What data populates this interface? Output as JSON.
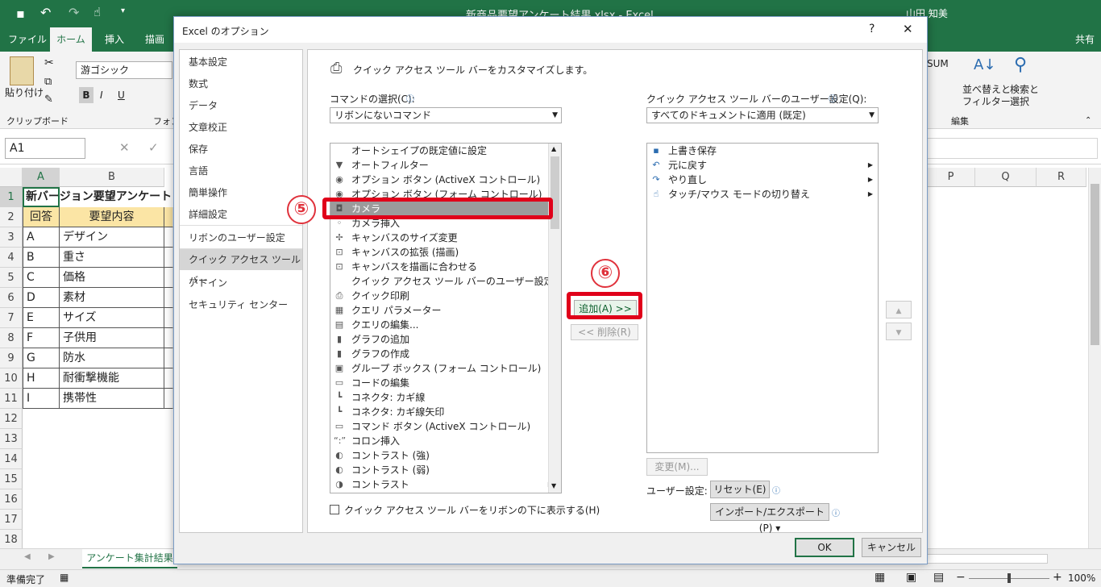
{
  "window": {
    "title": "新商品要望アンケート結果.xlsx  -  Excel",
    "user": "山田 知美"
  },
  "ribbon": {
    "tabs": [
      "ファイル",
      "ホーム",
      "挿入",
      "描画"
    ],
    "share": "共有",
    "paste": "貼り付け",
    "clipboard": "クリップボード",
    "font_name": "游ゴシック",
    "font_group": "フォン",
    "sum": "SUM",
    "sort_filter": "並べ替えと\nフィルター",
    "find_select": "検索と\n選択",
    "edit_group": "編集",
    "bold": "B",
    "italic": "I",
    "underline": "U"
  },
  "formula": {
    "namebox": "A1"
  },
  "sheet": {
    "columns": [
      "A",
      "B",
      "P",
      "Q",
      "R"
    ],
    "rows": [
      "1",
      "2",
      "3",
      "4",
      "5",
      "6",
      "7",
      "8",
      "9",
      "10",
      "11",
      "12",
      "13",
      "14",
      "15",
      "16",
      "17",
      "18"
    ],
    "cells": [
      [
        "新バージョン要望アンケート",
        ""
      ],
      [
        "回答",
        "要望内容"
      ],
      [
        "A",
        "デザイン"
      ],
      [
        "B",
        "重さ"
      ],
      [
        "C",
        "価格"
      ],
      [
        "D",
        "素材"
      ],
      [
        "E",
        "サイズ"
      ],
      [
        "F",
        "子供用"
      ],
      [
        "G",
        "防水"
      ],
      [
        "H",
        "耐衝撃機能"
      ],
      [
        "I",
        "携帯性"
      ]
    ],
    "tab": "アンケート集計結果"
  },
  "status": {
    "ready": "準備完了",
    "zoom": "100%"
  },
  "dialog": {
    "title": "Excel のオプション",
    "help": "?",
    "close": "✕",
    "nav": [
      "基本設定",
      "数式",
      "データ",
      "文章校正",
      "保存",
      "言語",
      "簡単操作",
      "詳細設定",
      "リボンのユーザー設定",
      "クイック アクセス ツール バー",
      "アドイン",
      "セキュリティ センター"
    ],
    "heading": "クイック アクセス ツール バーをカスタマイズします。",
    "choose_label": "コマンドの選択(C):",
    "choose_value": "リボンにないコマンド",
    "qat_label": "クイック アクセス ツール バーのユーザー設定(Q):",
    "qat_value": "すべてのドキュメントに適用 (既定)",
    "commands": [
      {
        "icon": "",
        "text": "オートシェイプの既定値に設定"
      },
      {
        "icon": "▼",
        "text": "オートフィルター"
      },
      {
        "icon": "◉",
        "text": "オプション ボタン (ActiveX コントロール)"
      },
      {
        "icon": "◉",
        "text": "オプション ボタン (フォーム コントロール)"
      },
      {
        "icon": "◘",
        "text": "カメラ"
      },
      {
        "icon": "◦",
        "text": "カメラ挿入"
      },
      {
        "icon": "✢",
        "text": "キャンバスのサイズ変更"
      },
      {
        "icon": "⊡",
        "text": "キャンバスの拡張 (描画)"
      },
      {
        "icon": "⊡",
        "text": "キャンバスを描画に合わせる"
      },
      {
        "icon": "",
        "text": "クイック アクセス ツール バーのユーザー設定..."
      },
      {
        "icon": "⎙",
        "text": "クイック印刷"
      },
      {
        "icon": "▦",
        "text": "クエリ パラメーター"
      },
      {
        "icon": "▤",
        "text": "クエリの編集..."
      },
      {
        "icon": "▮",
        "text": "グラフの追加"
      },
      {
        "icon": "▮",
        "text": "グラフの作成"
      },
      {
        "icon": "▣",
        "text": "グループ ボックス (フォーム コントロール)"
      },
      {
        "icon": "▭",
        "text": "コードの編集"
      },
      {
        "icon": "┗",
        "text": "コネクタ: カギ線"
      },
      {
        "icon": "┗",
        "text": "コネクタ: カギ線矢印"
      },
      {
        "icon": "▭",
        "text": "コマンド ボタン (ActiveX コントロール)"
      },
      {
        "icon": "“:”",
        "text": "コロン挿入"
      },
      {
        "icon": "◐",
        "text": "コントラスト (強)"
      },
      {
        "icon": "◐",
        "text": "コントラスト (弱)"
      },
      {
        "icon": "◑",
        "text": "コントラスト"
      }
    ],
    "qat_items": [
      {
        "icon": "▪",
        "text": "上書き保存"
      },
      {
        "icon": "↶",
        "text": "元に戻す"
      },
      {
        "icon": "↷",
        "text": "やり直し"
      },
      {
        "icon": "☝",
        "text": "タッチ/マウス モードの切り替え"
      }
    ],
    "add": "追加(A) >>",
    "remove": "<< 削除(R)",
    "modify": "変更(M)...",
    "below_ribbon": "クイック アクセス ツール バーをリボンの下に表示する(H)",
    "user_settings": "ユーザー設定:",
    "reset": "リセット(E) ▾",
    "import_export": "インポート/エクスポート(P) ▾",
    "ok": "OK",
    "cancel": "キャンセル"
  },
  "annotations": {
    "step5": "⑤",
    "step6": "⑥"
  },
  "colors": {
    "excel_green": "#217346",
    "highlight_red": "#e0001a",
    "selected_item": "#9b9b9b"
  }
}
